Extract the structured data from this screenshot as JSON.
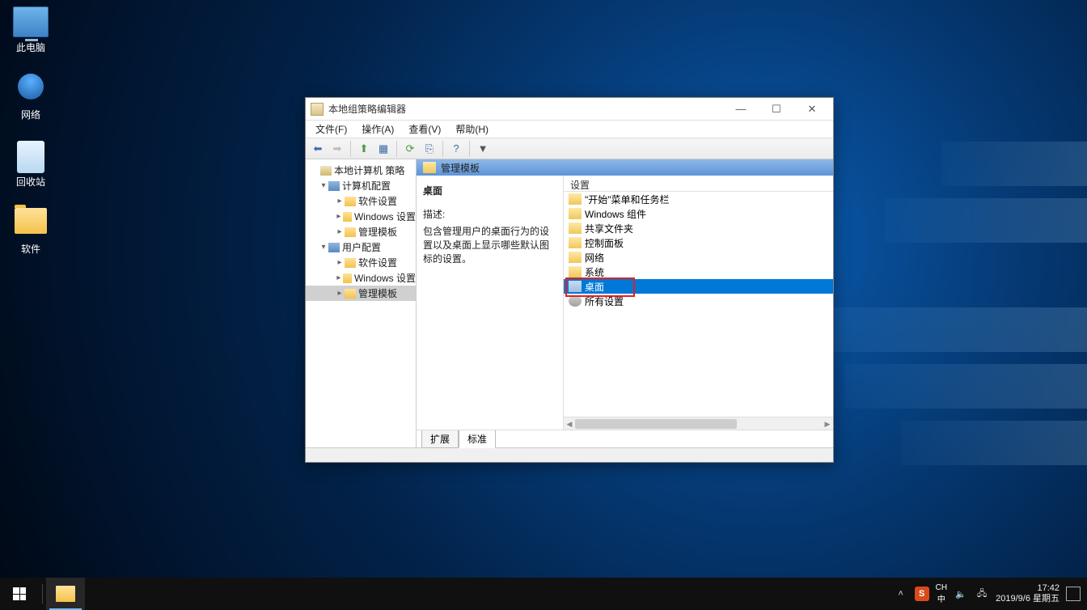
{
  "desktop": {
    "icons": [
      "此电脑",
      "网络",
      "回收站",
      "软件"
    ]
  },
  "window": {
    "title": "本地组策略编辑器",
    "menus": [
      "文件(F)",
      "操作(A)",
      "查看(V)",
      "帮助(H)"
    ],
    "tree": {
      "root": "本地计算机 策略",
      "computer_cfg": "计算机配置",
      "user_cfg": "用户配置",
      "children": [
        "软件设置",
        "Windows 设置",
        "管理模板"
      ]
    },
    "content": {
      "header": "管理模板",
      "detail_title": "桌面",
      "desc_label": "描述:",
      "desc_text": "包含管理用户的桌面行为的设置以及桌面上显示哪些默认图标的设置。",
      "column": "设置",
      "items": [
        "\"开始\"菜单和任务栏",
        "Windows 组件",
        "共享文件夹",
        "控制面板",
        "网络",
        "系统",
        "桌面",
        "所有设置"
      ],
      "selected_index": 6
    },
    "tabs": [
      "扩展",
      "标准"
    ]
  },
  "taskbar": {
    "ime_lang": "CH",
    "ime_mode": "中",
    "time": "17:42",
    "date": "2019/9/6 星期五",
    "sogou": "S"
  }
}
